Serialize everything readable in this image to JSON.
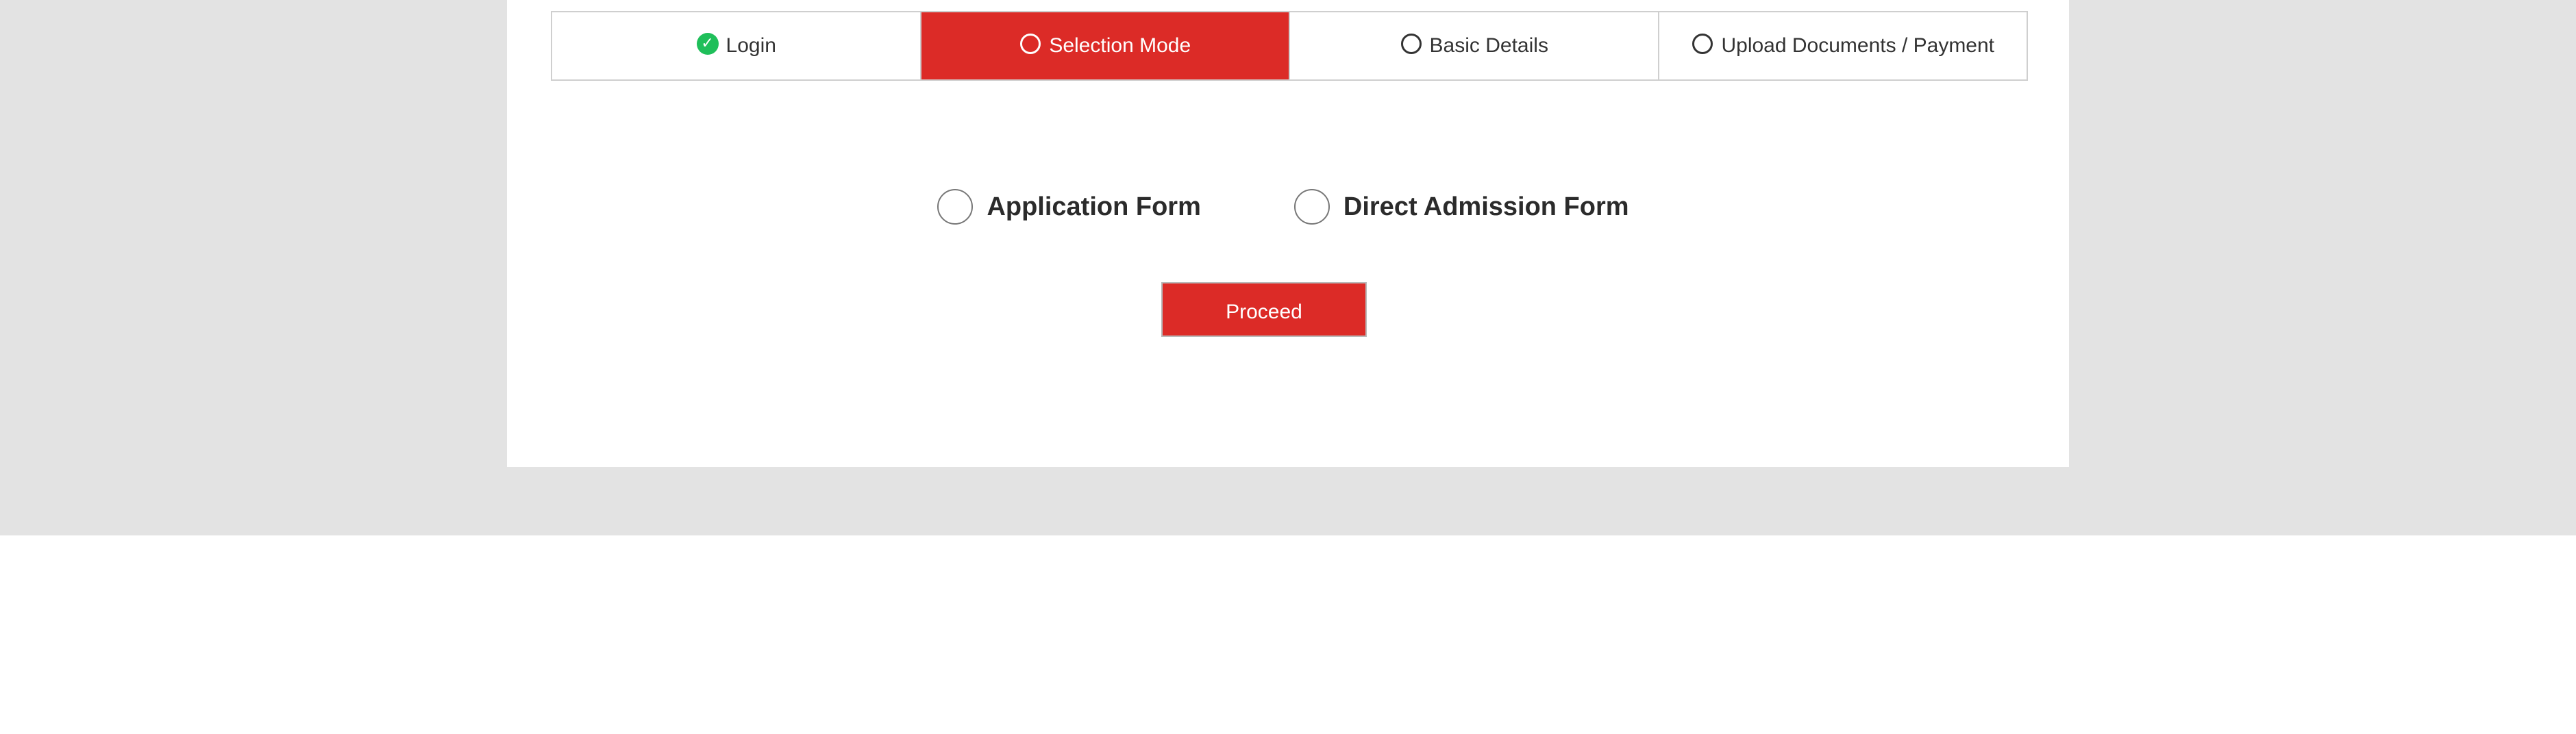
{
  "stepper": {
    "steps": [
      {
        "label": "Login",
        "state": "completed",
        "icon": "check-circle-icon"
      },
      {
        "label": "Selection Mode",
        "state": "active",
        "icon": "circle-outline-icon"
      },
      {
        "label": "Basic Details",
        "state": "pending",
        "icon": "circle-outline-icon"
      },
      {
        "label": "Upload Documents / Payment",
        "state": "pending",
        "icon": "circle-outline-icon"
      }
    ]
  },
  "form": {
    "options": [
      {
        "label": "Application Form",
        "selected": false
      },
      {
        "label": "Direct Admission Form",
        "selected": false
      }
    ],
    "proceed_label": "Proceed"
  },
  "colors": {
    "accent": "#dc2b27",
    "success": "#1fbf5a",
    "page_background": "#e3e3e3"
  }
}
